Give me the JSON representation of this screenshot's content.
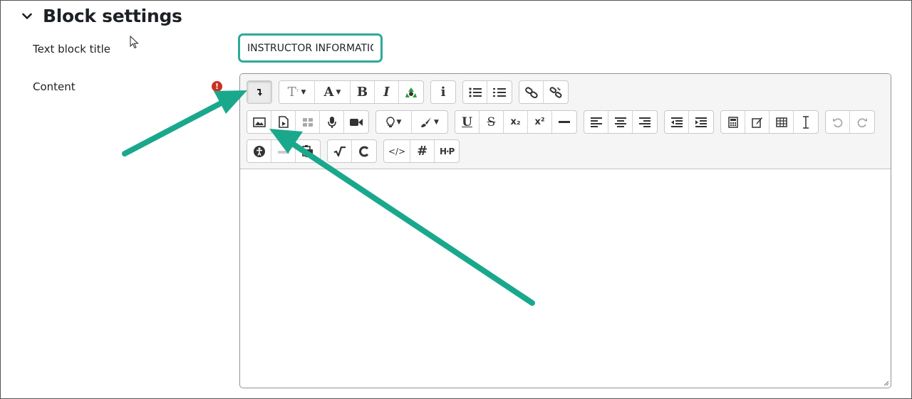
{
  "section": {
    "title": "Block settings"
  },
  "form": {
    "title_label": "Text block title",
    "title_value": "INSTRUCTOR INFORMATIC",
    "content_label": "Content",
    "required_icon": "!"
  },
  "toolbar": {
    "row1": [
      [
        "collapse-icon"
      ],
      [
        "font-size-icon",
        "font-color-icon",
        "bold-icon",
        "italic-icon",
        "recycle-icon"
      ],
      [
        "info-icon"
      ],
      [
        "unordered-list-icon",
        "ordered-list-icon"
      ],
      [
        "link-icon",
        "unlink-icon"
      ]
    ],
    "row2": [
      [
        "image-icon",
        "media-file-icon",
        "manage-files-icon",
        "record-audio-icon",
        "record-video-icon"
      ],
      [
        "lightbulb-icon",
        "paintbrush-icon"
      ],
      [
        "underline-icon",
        "strikethrough-icon",
        "subscript-icon",
        "superscript-icon",
        "horizontal-rule-icon"
      ],
      [
        "align-left-icon",
        "align-center-icon",
        "align-right-icon"
      ],
      [
        "outdent-icon",
        "indent-icon"
      ],
      [
        "calculator-icon",
        "edit-icon",
        "table-icon",
        "clear-formatting-icon"
      ],
      [
        "undo-icon",
        "redo-icon"
      ]
    ],
    "row3": [
      [
        "accessibility-icon",
        "screenreader-icon",
        "paste-icon"
      ],
      [
        "equation-icon",
        "special-char-icon"
      ],
      [
        "html-code-icon",
        "hashtag-icon",
        "h5p-icon"
      ]
    ],
    "labels": {
      "bold": "B",
      "italic": "I",
      "info": "i",
      "font_size": "T",
      "font_color": "A",
      "underline": "U",
      "strike": "S",
      "subscript": "x₂",
      "superscript": "x²",
      "hashtag": "#",
      "h5p": "H·P",
      "html": "</>"
    }
  },
  "colors": {
    "accent": "#2fa99a",
    "arrow": "#1aa88d",
    "required": "#ca3120"
  }
}
